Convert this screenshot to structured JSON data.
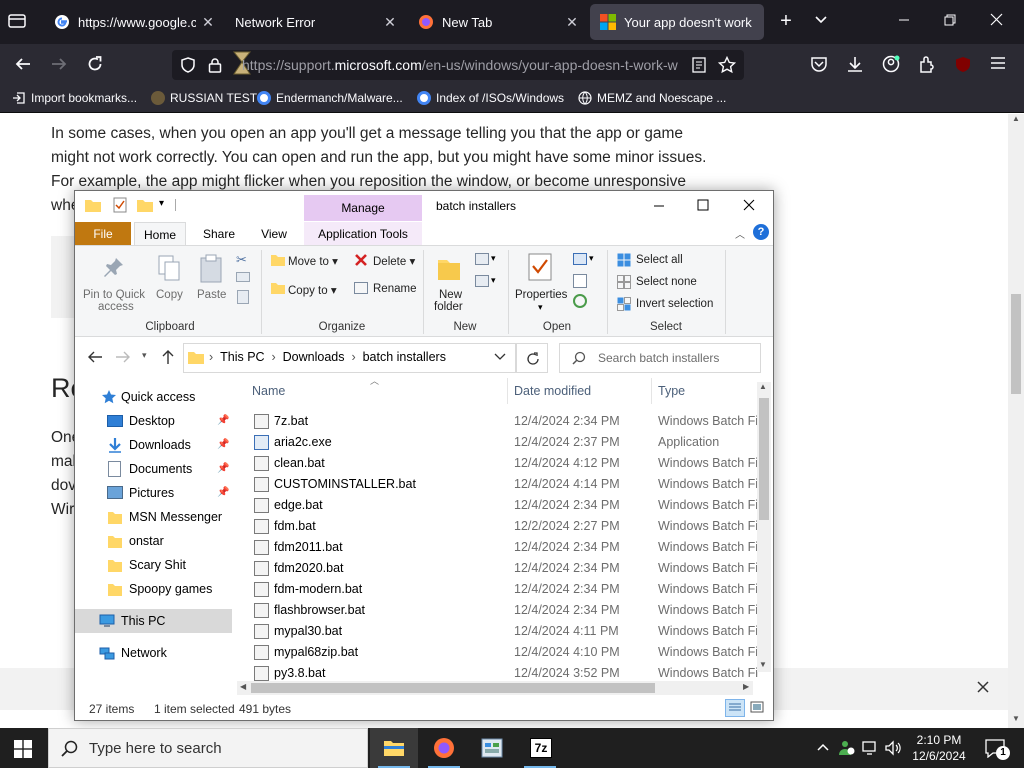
{
  "browser": {
    "tabs": [
      {
        "title": "https://www.google.co",
        "selected": false
      },
      {
        "title": "Network Error",
        "selected": false
      },
      {
        "title": "New Tab",
        "selected": false
      },
      {
        "title": "Your app doesn't work",
        "selected": true
      }
    ],
    "url_prefix": "https://support.",
    "url_domain": "microsoft.com",
    "url_rest": "/en-us/windows/your-app-doesn-t-work-w",
    "extension_badge": "3",
    "bookmarks": [
      "Import bookmarks...",
      "RUSSIAN TEST",
      "Endermanch/Malware...",
      "Index of /ISOs/Windows",
      "MEMZ and Noescape ..."
    ]
  },
  "page": {
    "paragraph_lines": [
      "In some cases, when you open an app you'll get a message telling you that the app or game",
      "might not work correctly. You can open and run the app, but you might have some minor issues.",
      "For example, the app might flicker when you reposition the window, or become unresponsive",
      "whe"
    ],
    "heading_fragment": "Re",
    "body_fragments": [
      "One",
      "mal",
      "dov",
      "Wir"
    ]
  },
  "explorer": {
    "window_title": "batch installers",
    "context_tab": "Manage",
    "ribbon_tabs": [
      "File",
      "Home",
      "Share",
      "View",
      "Application Tools"
    ],
    "clipboard": {
      "pin_label_1": "Pin to Quick",
      "pin_label_2": "access",
      "copy": "Copy",
      "paste": "Paste",
      "group": "Clipboard"
    },
    "organize": {
      "move_to": "Move to",
      "copy_to": "Copy to",
      "delete": "Delete",
      "rename": "Rename",
      "group": "Organize"
    },
    "new": {
      "new_folder_1": "New",
      "new_folder_2": "folder",
      "group": "New"
    },
    "open": {
      "properties": "Properties",
      "group": "Open"
    },
    "select": {
      "select_all": "Select all",
      "select_none": "Select none",
      "invert": "Invert selection",
      "group": "Select"
    },
    "breadcrumb": [
      "This PC",
      "Downloads",
      "batch installers"
    ],
    "search_placeholder": "Search batch installers",
    "nav": {
      "quick_access": "Quick access",
      "pinned": [
        "Desktop",
        "Downloads",
        "Documents",
        "Pictures"
      ],
      "folders": [
        "MSN Messenger",
        "onstar",
        "Scary Shit",
        "Spoopy games"
      ],
      "this_pc": "This PC",
      "network": "Network"
    },
    "columns": [
      "Name",
      "Date modified",
      "Type"
    ],
    "files": [
      {
        "name": "7z.bat",
        "date": "12/4/2024 2:34 PM",
        "type": "Windows Batch File"
      },
      {
        "name": "aria2c.exe",
        "date": "12/4/2024 2:37 PM",
        "type": "Application"
      },
      {
        "name": "clean.bat",
        "date": "12/4/2024 4:12 PM",
        "type": "Windows Batch File"
      },
      {
        "name": "CUSTOMINSTALLER.bat",
        "date": "12/4/2024 4:14 PM",
        "type": "Windows Batch File"
      },
      {
        "name": "edge.bat",
        "date": "12/4/2024 2:34 PM",
        "type": "Windows Batch File"
      },
      {
        "name": "fdm.bat",
        "date": "12/2/2024 2:27 PM",
        "type": "Windows Batch File"
      },
      {
        "name": "fdm2011.bat",
        "date": "12/4/2024 2:34 PM",
        "type": "Windows Batch File"
      },
      {
        "name": "fdm2020.bat",
        "date": "12/4/2024 2:34 PM",
        "type": "Windows Batch File"
      },
      {
        "name": "fdm-modern.bat",
        "date": "12/4/2024 2:34 PM",
        "type": "Windows Batch File"
      },
      {
        "name": "flashbrowser.bat",
        "date": "12/4/2024 2:34 PM",
        "type": "Windows Batch File"
      },
      {
        "name": "mypal30.bat",
        "date": "12/4/2024 4:11 PM",
        "type": "Windows Batch File"
      },
      {
        "name": "mypal68zip.bat",
        "date": "12/4/2024 4:10 PM",
        "type": "Windows Batch File"
      },
      {
        "name": "py3.8.bat",
        "date": "12/4/2024 3:52 PM",
        "type": "Windows Batch File"
      }
    ],
    "status": {
      "items": "27 items",
      "selected": "1 item selected",
      "size": "491 bytes"
    }
  },
  "taskbar": {
    "search_placeholder": "Type here to search",
    "time": "2:10 PM",
    "date": "12/6/2024",
    "notification_count": "1"
  }
}
